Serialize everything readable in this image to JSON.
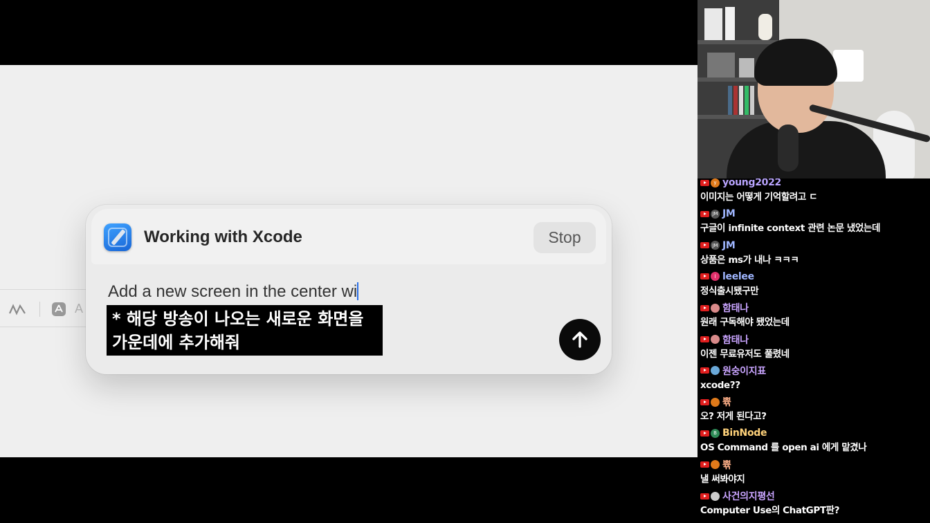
{
  "panel": {
    "title": "Working with Xcode",
    "stop_label": "Stop",
    "prompt_text": "Add a new screen in the center wi",
    "send_icon": "arrow-up-icon"
  },
  "subtitle": {
    "line1": "* 해당 방송이 나오는 새로운 화면을",
    "line2": "가운데에 추가해줘"
  },
  "background_toolbar": {
    "ghost_letter": "A"
  },
  "chat": {
    "messages": [
      {
        "author": "young2022",
        "text": "이미지는 어떻게 기억할려고 ㄷ",
        "color": "#b9a4ff",
        "avatar_color": "#e07a1a",
        "avatar_text": "y"
      },
      {
        "author": "JM",
        "text": "구글이 infinite context 관련 논문 냈었는데",
        "color": "#9fb6ff",
        "avatar_color": "#555555",
        "avatar_text": "JM"
      },
      {
        "author": "JM",
        "text": "상품은 ms가 내나 ㅋㅋㅋ",
        "color": "#9fb6ff",
        "avatar_color": "#555555",
        "avatar_text": "JM"
      },
      {
        "author": "leelee",
        "text": "정식출시됐구만",
        "color": "#9fb6ff",
        "avatar_color": "#e0306a",
        "avatar_text": "l"
      },
      {
        "author": "함태나",
        "text": "원래 구독해야 됐었는데",
        "color": "#c9a4ff",
        "avatar_color": "#d98a8a",
        "avatar_text": ""
      },
      {
        "author": "함태나",
        "text": "이젠 무료유저도 풀렸네",
        "color": "#c9a4ff",
        "avatar_color": "#d98a8a",
        "avatar_text": ""
      },
      {
        "author": "원숭이지표",
        "text": "xcode??",
        "color": "#c9a4ff",
        "avatar_color": "#6aa8d8",
        "avatar_text": ""
      },
      {
        "author": "쀾",
        "text": "오? 저게 된다고?",
        "color": "#ffb089",
        "avatar_color": "#e07a1a",
        "avatar_text": ""
      },
      {
        "author": "BinNode",
        "text": "OS Command 를 open ai 에게 맡겼나",
        "color": "#ffd27a",
        "avatar_color": "#2e8b57",
        "avatar_text": "B"
      },
      {
        "author": "쀾",
        "text": "낼 써봐야지",
        "color": "#ffb089",
        "avatar_color": "#e07a1a",
        "avatar_text": ""
      },
      {
        "author": "사건의지평선",
        "text": "Computer Use의 ChatGPT판?",
        "color": "#c9a4ff",
        "avatar_color": "#cccccc",
        "avatar_text": ""
      }
    ]
  }
}
